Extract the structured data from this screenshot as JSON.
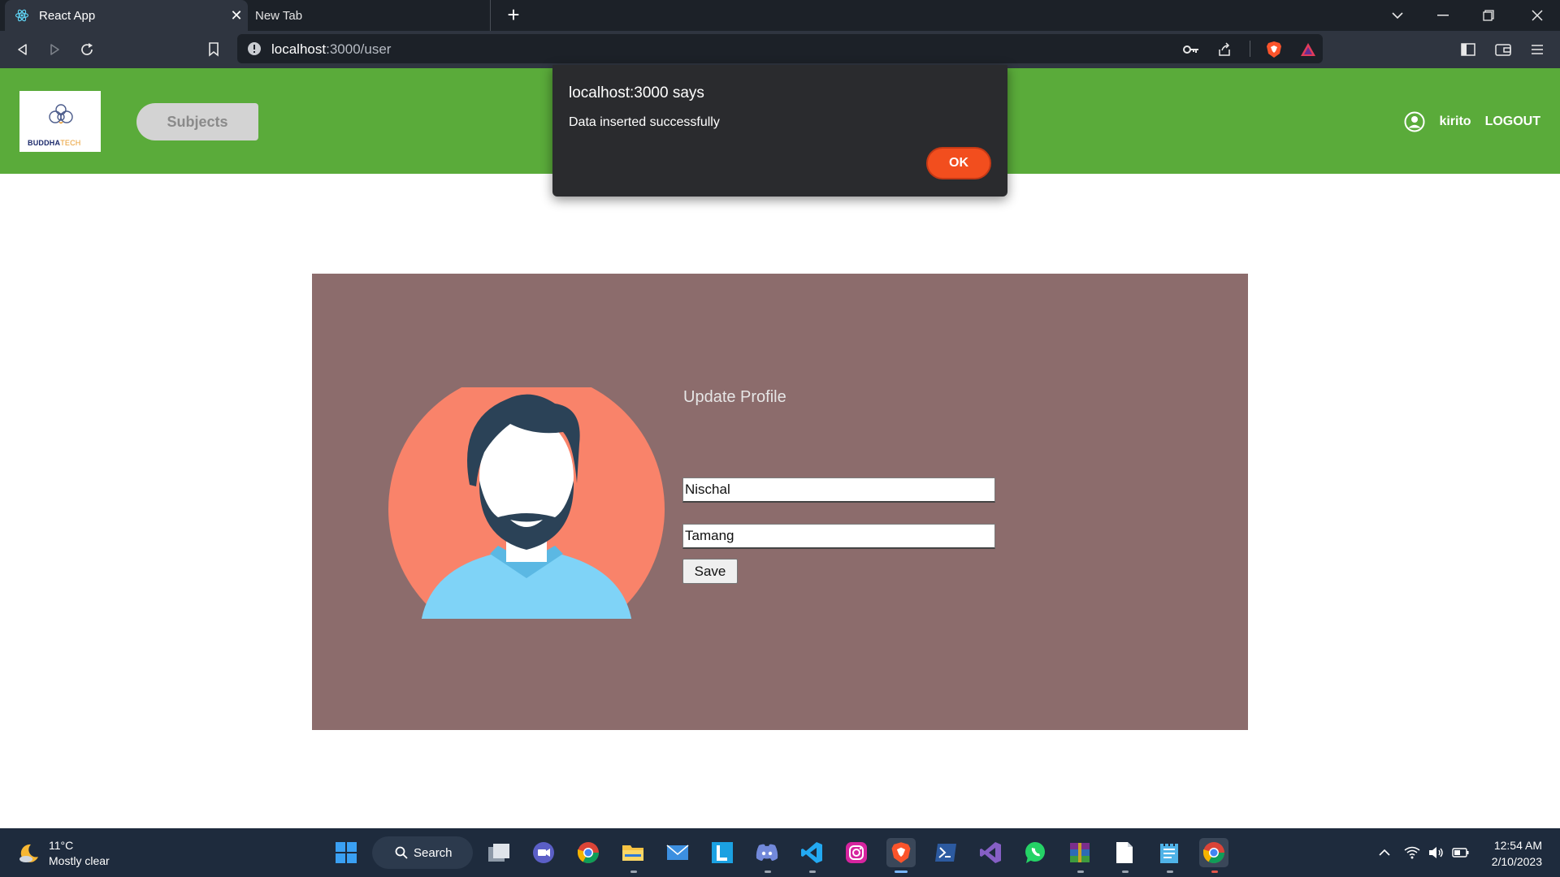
{
  "browser": {
    "tabs": [
      {
        "title": "React App",
        "active": true
      },
      {
        "title": "New Tab",
        "active": false
      }
    ],
    "url": {
      "host": "localhost",
      "path": ":3000/user"
    }
  },
  "app": {
    "logo": {
      "brand_part1": "BUDDHA",
      "brand_part2": "TECH"
    },
    "nav": {
      "subjects_label": "Subjects"
    },
    "user": {
      "name": "kirito",
      "logout_label": "LOGOUT"
    }
  },
  "profile": {
    "title": "Update Profile",
    "first_name": "Nischal",
    "last_name": "Tamang",
    "save_label": "Save"
  },
  "alert": {
    "title": "localhost:3000 says",
    "message": "Data inserted successfully",
    "ok_label": "OK"
  },
  "taskbar": {
    "weather": {
      "temp": "11°C",
      "condition": "Mostly clear"
    },
    "search_label": "Search",
    "time": "12:54 AM",
    "date": "2/10/2023"
  },
  "colors": {
    "nav_green": "#5aab3a",
    "card_bg": "#8c6c6c",
    "alert_ok": "#f24e1e",
    "avatar_circle": "#f9836a"
  }
}
